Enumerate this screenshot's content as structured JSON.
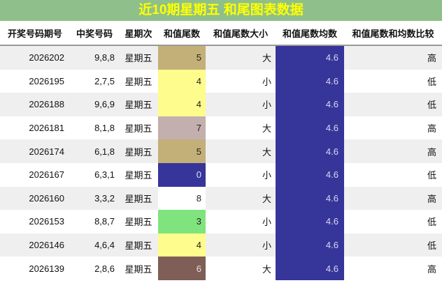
{
  "title": "近10期星期五 和尾图表数据",
  "headers": [
    "开奖号码期号",
    "中奖号码",
    "星期次",
    "和值尾数",
    "和值尾数大小",
    "和值尾数均数",
    "和值尾数和均数比较"
  ],
  "rows": [
    {
      "period": "2026202",
      "numbers": "9,8,8",
      "day": "星期五",
      "tail": "5",
      "size": "大",
      "avg": "4.6",
      "cmp": "高",
      "tail_bg": "#c2b078",
      "tail_fg": "#222222"
    },
    {
      "period": "2026195",
      "numbers": "2,7,5",
      "day": "星期五",
      "tail": "4",
      "size": "小",
      "avg": "4.6",
      "cmp": "低",
      "tail_bg": "#fdfc8c",
      "tail_fg": "#222222"
    },
    {
      "period": "2026188",
      "numbers": "9,6,9",
      "day": "星期五",
      "tail": "4",
      "size": "小",
      "avg": "4.6",
      "cmp": "低",
      "tail_bg": "#fdfc8c",
      "tail_fg": "#222222"
    },
    {
      "period": "2026181",
      "numbers": "8,1,8",
      "day": "星期五",
      "tail": "7",
      "size": "大",
      "avg": "4.6",
      "cmp": "高",
      "tail_bg": "#c3b0ae",
      "tail_fg": "#222222"
    },
    {
      "period": "2026174",
      "numbers": "6,1,8",
      "day": "星期五",
      "tail": "5",
      "size": "大",
      "avg": "4.6",
      "cmp": "高",
      "tail_bg": "#c2b078",
      "tail_fg": "#222222"
    },
    {
      "period": "2026167",
      "numbers": "6,3,1",
      "day": "星期五",
      "tail": "0",
      "size": "小",
      "avg": "4.6",
      "cmp": "低",
      "tail_bg": "#36359a",
      "tail_fg": "#e0e0f4"
    },
    {
      "period": "2026160",
      "numbers": "3,3,2",
      "day": "星期五",
      "tail": "8",
      "size": "大",
      "avg": "4.6",
      "cmp": "高",
      "tail_bg": "#ffffff",
      "tail_fg": "#222222"
    },
    {
      "period": "2026153",
      "numbers": "8,8,7",
      "day": "星期五",
      "tail": "3",
      "size": "小",
      "avg": "4.6",
      "cmp": "低",
      "tail_bg": "#80e47e",
      "tail_fg": "#222222"
    },
    {
      "period": "2026146",
      "numbers": "4,6,4",
      "day": "星期五",
      "tail": "4",
      "size": "小",
      "avg": "4.6",
      "cmp": "低",
      "tail_bg": "#fdfc8c",
      "tail_fg": "#222222"
    },
    {
      "period": "2026139",
      "numbers": "2,8,6",
      "day": "星期五",
      "tail": "6",
      "size": "大",
      "avg": "4.6",
      "cmp": "高",
      "tail_bg": "#7e5e56",
      "tail_fg": "#e8e0dc"
    }
  ]
}
